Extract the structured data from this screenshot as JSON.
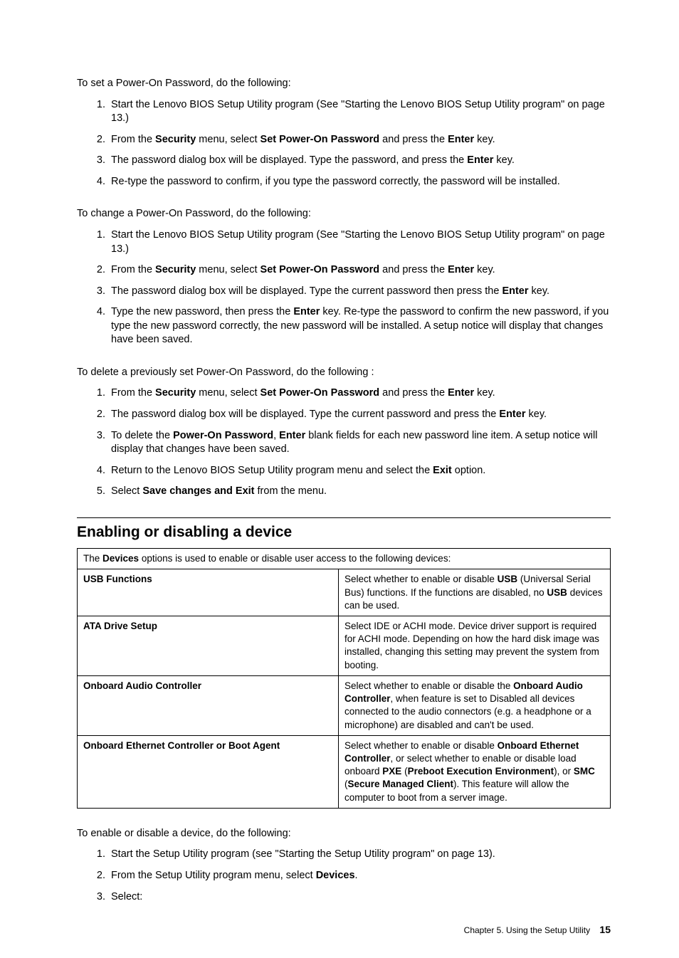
{
  "set": {
    "intro": "To set a Power-On Password, do the following:",
    "items": [
      [
        [
          "Start the Lenovo BIOS Setup Utility program (See \"Starting the Lenovo BIOS Setup Utility program\" on page 13.)"
        ]
      ],
      [
        [
          "From the "
        ],
        [
          "b",
          "Security"
        ],
        [
          " menu, select "
        ],
        [
          "b",
          "Set Power-On Password"
        ],
        [
          " and press the "
        ],
        [
          "b",
          "Enter"
        ],
        [
          " key."
        ]
      ],
      [
        [
          "The password dialog box will be displayed. Type the password, and press the "
        ],
        [
          "b",
          "Enter"
        ],
        [
          " key."
        ]
      ],
      [
        [
          "Re-type the password to confirm, if you type the password correctly, the password will be installed."
        ]
      ]
    ]
  },
  "change": {
    "intro": "To change a Power-On Password, do the following:",
    "items": [
      [
        [
          "Start the Lenovo BIOS Setup Utility program (See \"Starting the Lenovo BIOS Setup Utility program\" on page 13.)"
        ]
      ],
      [
        [
          "From the "
        ],
        [
          "b",
          "Security"
        ],
        [
          " menu, select "
        ],
        [
          "b",
          "Set Power-On Password"
        ],
        [
          " and press the "
        ],
        [
          "b",
          "Enter"
        ],
        [
          " key."
        ]
      ],
      [
        [
          "The password dialog box will be displayed. Type the current password then press the "
        ],
        [
          "b",
          "Enter"
        ],
        [
          " key."
        ]
      ],
      [
        [
          "Type the new password, then press the "
        ],
        [
          "b",
          "Enter"
        ],
        [
          " key. Re-type the password to confirm the new password, if you type the new password correctly, the new password will be installed. A setup notice will display that changes have been saved."
        ]
      ]
    ]
  },
  "delete": {
    "intro": "To delete a previously set Power-On Password, do the following :",
    "items": [
      [
        [
          "From the "
        ],
        [
          "b",
          "Security"
        ],
        [
          " menu, select "
        ],
        [
          "b",
          "Set Power-On Password"
        ],
        [
          " and press the "
        ],
        [
          "b",
          "Enter"
        ],
        [
          " key."
        ]
      ],
      [
        [
          "The password dialog box will be displayed. Type the current password and press the "
        ],
        [
          "b",
          "Enter"
        ],
        [
          " key."
        ]
      ],
      [
        [
          "To delete the "
        ],
        [
          "b",
          "Power-On Password"
        ],
        [
          ", "
        ],
        [
          "b",
          "Enter"
        ],
        [
          " blank fields for each new password line item. A setup notice will display that changes have been saved."
        ]
      ],
      [
        [
          "Return to the Lenovo BIOS Setup Utility program menu and select the "
        ],
        [
          "b",
          "Exit"
        ],
        [
          " option."
        ]
      ],
      [
        [
          "Select "
        ],
        [
          "b",
          "Save changes and Exit"
        ],
        [
          " from the menu."
        ]
      ]
    ]
  },
  "heading": "Enabling or disabling a device",
  "table": {
    "header": [
      [
        "The "
      ],
      [
        "b",
        "Devices"
      ],
      [
        " options is used to enable or disable user access to the following devices:"
      ]
    ],
    "rows": [
      {
        "name": "USB Functions",
        "desc": [
          [
            "Select whether to enable or disable "
          ],
          [
            "b",
            "USB"
          ],
          [
            " (Universal Serial Bus) functions. If the functions are disabled, no "
          ],
          [
            "b",
            "USB"
          ],
          [
            " devices can be used."
          ]
        ]
      },
      {
        "name": "ATA Drive Setup",
        "desc": [
          [
            "Select IDE or ACHI mode. Device driver support is required for ACHI mode. Depending on how the hard disk image was installed, changing this setting may prevent the system from booting."
          ]
        ]
      },
      {
        "name": "Onboard Audio Controller",
        "desc": [
          [
            "Select whether to enable or disable the "
          ],
          [
            "b",
            "Onboard Audio Controller"
          ],
          [
            ", when feature is set to Disabled all devices connected to the audio connectors (e.g. a headphone or a microphone) are disabled and can't be used."
          ]
        ]
      },
      {
        "name": "Onboard Ethernet Controller or Boot Agent",
        "desc": [
          [
            "Select whether to enable or disable "
          ],
          [
            "b",
            "Onboard Ethernet Controller"
          ],
          [
            ", or select whether to enable or disable load onboard "
          ],
          [
            "b",
            "PXE"
          ],
          [
            " ("
          ],
          [
            "b",
            "Preboot Execution Environment"
          ],
          [
            "), or "
          ],
          [
            "b",
            "SMC"
          ],
          [
            " ("
          ],
          [
            "b",
            "Secure Managed Client"
          ],
          [
            "). This feature will allow the computer to boot from a server image."
          ]
        ]
      }
    ]
  },
  "enable": {
    "intro": "To enable or disable a device, do the following:",
    "items": [
      [
        [
          "Start the Setup Utility program (see \"Starting the Setup Utility program\" on page 13)."
        ]
      ],
      [
        [
          "From the Setup Utility program menu, select "
        ],
        [
          "b",
          "Devices"
        ],
        [
          "."
        ]
      ],
      [
        [
          "Select:"
        ]
      ]
    ]
  },
  "footer": {
    "chapter": "Chapter 5. Using the Setup Utility",
    "page": "15"
  }
}
